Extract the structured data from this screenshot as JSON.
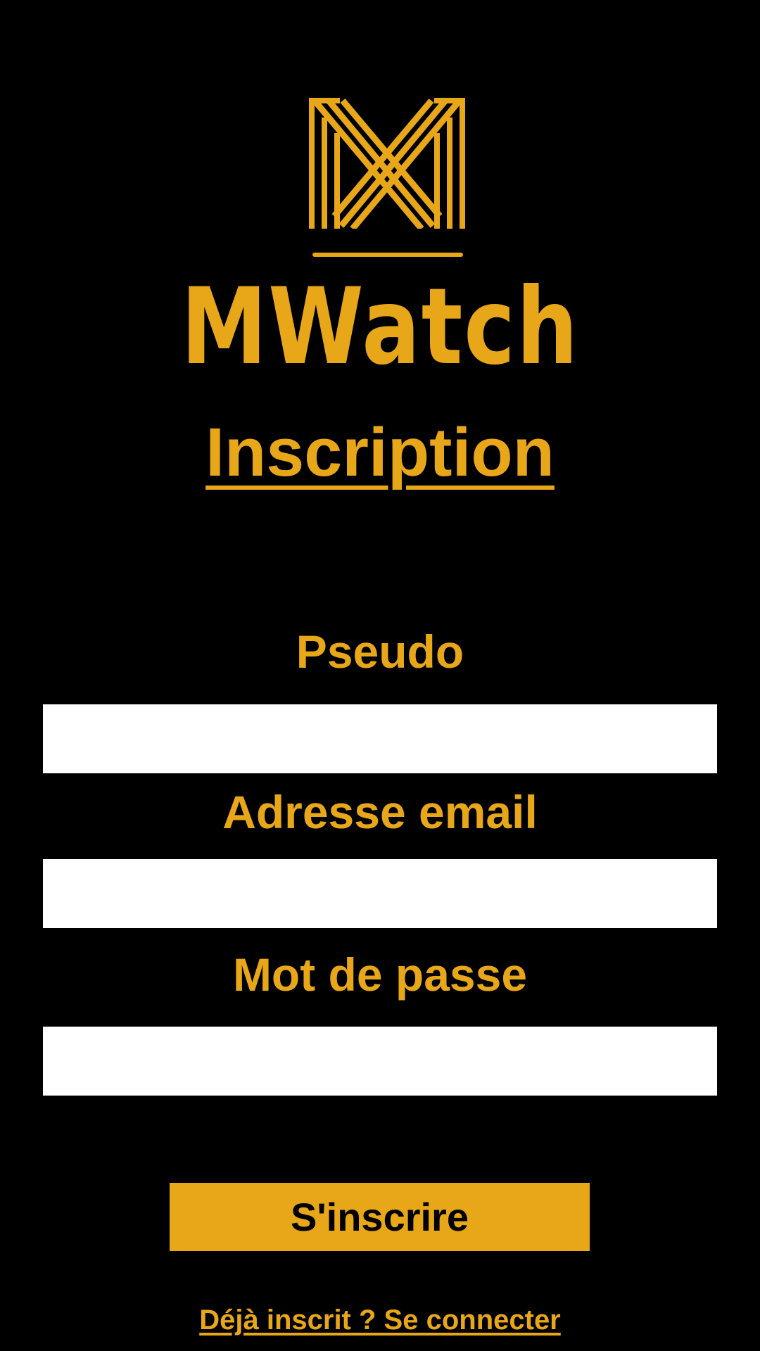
{
  "brand": {
    "logo_icon": "mwatch-monogram-icon",
    "name": "MWatch"
  },
  "page": {
    "title": "Inscription"
  },
  "form": {
    "fields": [
      {
        "label": "Pseudo",
        "value": "",
        "placeholder": ""
      },
      {
        "label": "Adresse email",
        "value": "",
        "placeholder": ""
      },
      {
        "label": "Mot de passe",
        "value": "",
        "placeholder": ""
      }
    ],
    "submit_label": "S'inscrire"
  },
  "footer": {
    "login_link": "Déjà inscrit ? Se connecter"
  },
  "colors": {
    "background": "#000000",
    "accent": "#e8a619",
    "input_background": "#ffffff",
    "button_text": "#000000"
  }
}
